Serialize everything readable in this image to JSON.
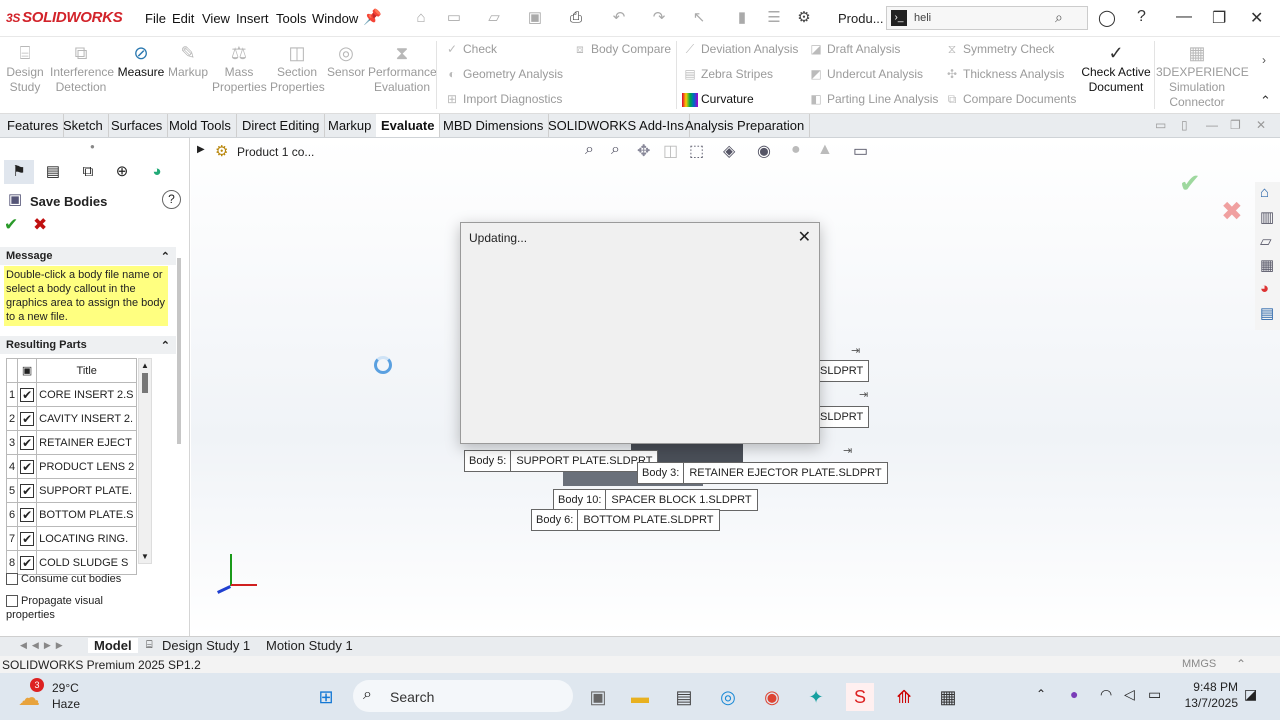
{
  "app": {
    "logo_ds": "3S",
    "logo_text": "SOLIDWORKS",
    "document": "Produ...",
    "search_value": "heli"
  },
  "menu": [
    "File",
    "Edit",
    "View",
    "Insert",
    "Tools",
    "Window"
  ],
  "ribbon": {
    "design_study": "Design Study",
    "interference": "Interference Detection",
    "measure": "Measure",
    "markup": "Markup",
    "mass_props": "Mass Properties",
    "section_props": "Section Properties",
    "sensor": "Sensor",
    "performance": "Performance Evaluation",
    "check": "Check",
    "geometry_analysis": "Geometry Analysis",
    "import_diag": "Import Diagnostics",
    "body_compare": "Body Compare",
    "deviation": "Deviation Analysis",
    "zebra": "Zebra Stripes",
    "curvature": "Curvature",
    "draft": "Draft Analysis",
    "undercut": "Undercut Analysis",
    "parting": "Parting Line Analysis",
    "symmetry": "Symmetry Check",
    "thickness": "Thickness Analysis",
    "compare_docs": "Compare Documents",
    "check_active": "Check Active Document",
    "sim_connector": "3DEXPERIENCE Simulation Connector"
  },
  "tabs": [
    "Features",
    "Sketch",
    "Surfaces",
    "Mold Tools",
    "Direct Editing",
    "Markup",
    "Evaluate",
    "MBD Dimensions",
    "SOLIDWORKS Add-Ins",
    "Analysis Preparation"
  ],
  "active_tab": "Evaluate",
  "tree_root": "Product 1 co...",
  "property_manager": {
    "title": "Save Bodies",
    "message_header": "Message",
    "message": "Double-click a body file name or select a body callout in the graphics area to assign the body to a new file.",
    "resulting_header": "Resulting Parts",
    "col_title": "Title",
    "parts": [
      {
        "n": "1",
        "title": "CORE INSERT 2.S"
      },
      {
        "n": "2",
        "title": "CAVITY INSERT 2."
      },
      {
        "n": "3",
        "title": "RETAINER EJECT"
      },
      {
        "n": "4",
        "title": "PRODUCT LENS 2"
      },
      {
        "n": "5",
        "title": "SUPPORT PLATE."
      },
      {
        "n": "6",
        "title": "BOTTOM PLATE.S"
      },
      {
        "n": "7",
        "title": "LOCATING RING."
      },
      {
        "n": "8",
        "title": "COLD SLUDGE S"
      }
    ],
    "opt_consume": "Consume cut bodies",
    "opt_propagate": "Propagate visual properties"
  },
  "callouts": [
    {
      "n": "",
      "f": ".SLDPRT"
    },
    {
      "n": "",
      "f": ".SLDPRT"
    },
    {
      "n": "Body 5:",
      "f": "SUPPORT PLATE.SLDPRT"
    },
    {
      "n": "Body 3:",
      "f": "RETAINER EJECTOR PLATE.SLDPRT"
    },
    {
      "n": "Body 10:",
      "f": "SPACER BLOCK 1.SLDPRT"
    },
    {
      "n": "Body 6:",
      "f": "BOTTOM PLATE.SLDPRT"
    }
  ],
  "dialog": {
    "title": "Updating..."
  },
  "bottom_tabs": [
    "Model",
    "Design Study 1",
    "Motion Study 1"
  ],
  "status": {
    "version": "SOLIDWORKS Premium 2025 SP1.2",
    "units": "MMGS"
  },
  "taskbar": {
    "badge": "3",
    "temp": "29°C",
    "weather": "Haze",
    "search": "Search",
    "time": "9:48 PM",
    "date": "13/7/2025"
  }
}
